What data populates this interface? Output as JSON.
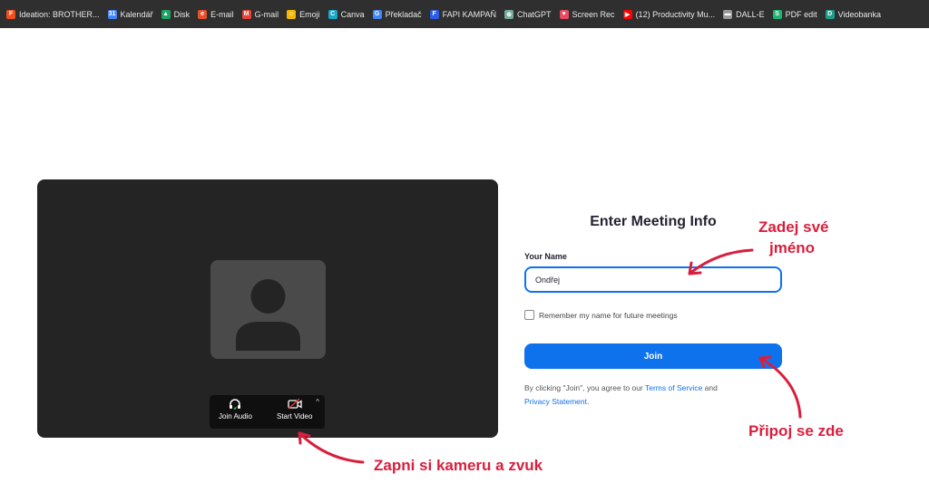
{
  "bookmarks": [
    {
      "label": "Ideation: BROTHER...",
      "icon": "figma-icon",
      "color": "#f24e1e",
      "glyph": "F"
    },
    {
      "label": "Kalendář",
      "icon": "calendar-icon",
      "color": "#4285f4",
      "glyph": "31"
    },
    {
      "label": "Disk",
      "icon": "drive-icon",
      "color": "#1fa463",
      "glyph": "▲"
    },
    {
      "label": "E-mail",
      "icon": "email-icon",
      "color": "#e8502b",
      "glyph": "e"
    },
    {
      "label": "G-mail",
      "icon": "gmail-icon",
      "color": "#ea4335",
      "glyph": "M"
    },
    {
      "label": "Emoji",
      "icon": "emoji-icon",
      "color": "#f5b800",
      "glyph": "☺"
    },
    {
      "label": "Canva",
      "icon": "canva-icon",
      "color": "#18a6c9",
      "glyph": "C"
    },
    {
      "label": "Překladač",
      "icon": "translate-icon",
      "color": "#4285f4",
      "glyph": "G"
    },
    {
      "label": "FAPI KAMPAŇ",
      "icon": "fapi-icon",
      "color": "#2b5ce6",
      "glyph": "F"
    },
    {
      "label": "ChatGPT",
      "icon": "chatgpt-icon",
      "color": "#74aa9c",
      "glyph": "⊛"
    },
    {
      "label": "Screen Rec",
      "icon": "screen-rec-icon",
      "color": "#e84a5f",
      "glyph": "♥"
    },
    {
      "label": "(12) Productivity Mu...",
      "icon": "youtube-icon",
      "color": "#ff0000",
      "glyph": "▶"
    },
    {
      "label": "DALL-E",
      "icon": "dalle-icon",
      "color": "#9a9a9a",
      "glyph": "▬"
    },
    {
      "label": "PDF edit",
      "icon": "pdf-edit-icon",
      "color": "#1fb370",
      "glyph": "S"
    },
    {
      "label": "Videobanka",
      "icon": "videobanka-icon",
      "color": "#1e9e8b",
      "glyph": "D"
    }
  ],
  "preview": {
    "join_audio_label": "Join Audio",
    "start_video_label": "Start Video"
  },
  "form": {
    "heading": "Enter Meeting Info",
    "name_label": "Your Name",
    "name_value": "Ondřej",
    "remember_label": "Remember my name for future meetings",
    "remember_checked": false,
    "join_label": "Join",
    "legal_prefix": "By clicking \"Join\", you agree to our",
    "terms_label": "Terms of Service",
    "legal_and": "and",
    "privacy_label": "Privacy Statement",
    "legal_suffix": "."
  },
  "annotations": {
    "name_hint_line1": "Zadej své",
    "name_hint_line2": "jméno",
    "join_hint": "Připoj se zde",
    "av_hint": "Zapni si kameru a zvuk"
  },
  "colors": {
    "accent": "#0e72ed",
    "annotation": "#d81f3d",
    "preview_bg": "#242424"
  }
}
